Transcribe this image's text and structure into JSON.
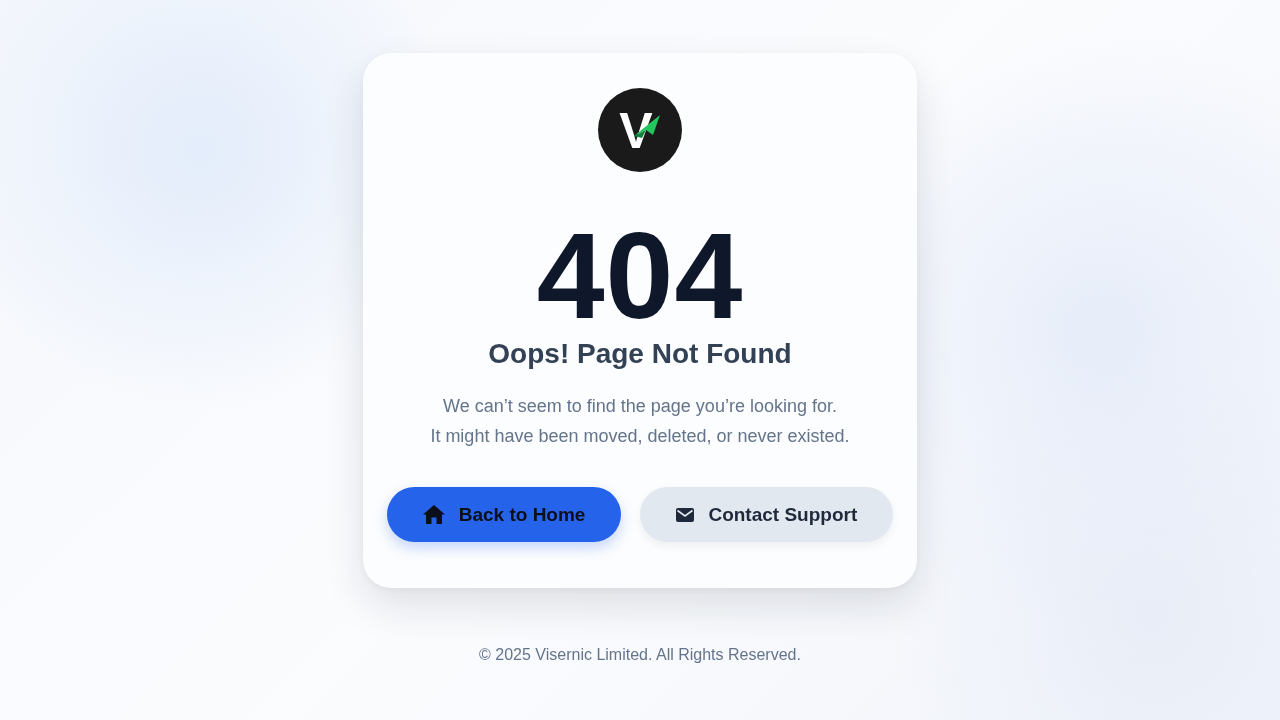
{
  "logo": {
    "mark": "V"
  },
  "error_code": "404",
  "title": "Oops! Page Not Found",
  "message": [
    "We can’t seem to find the page you’re looking for.",
    "It might have been moved, deleted, or never existed."
  ],
  "buttons": [
    {
      "label": "Back to Home",
      "kind": "primary"
    },
    {
      "label": "Contact Support",
      "kind": "secondary"
    }
  ],
  "footer": "© 2025 Visernic Limited. All Rights Reserved."
}
